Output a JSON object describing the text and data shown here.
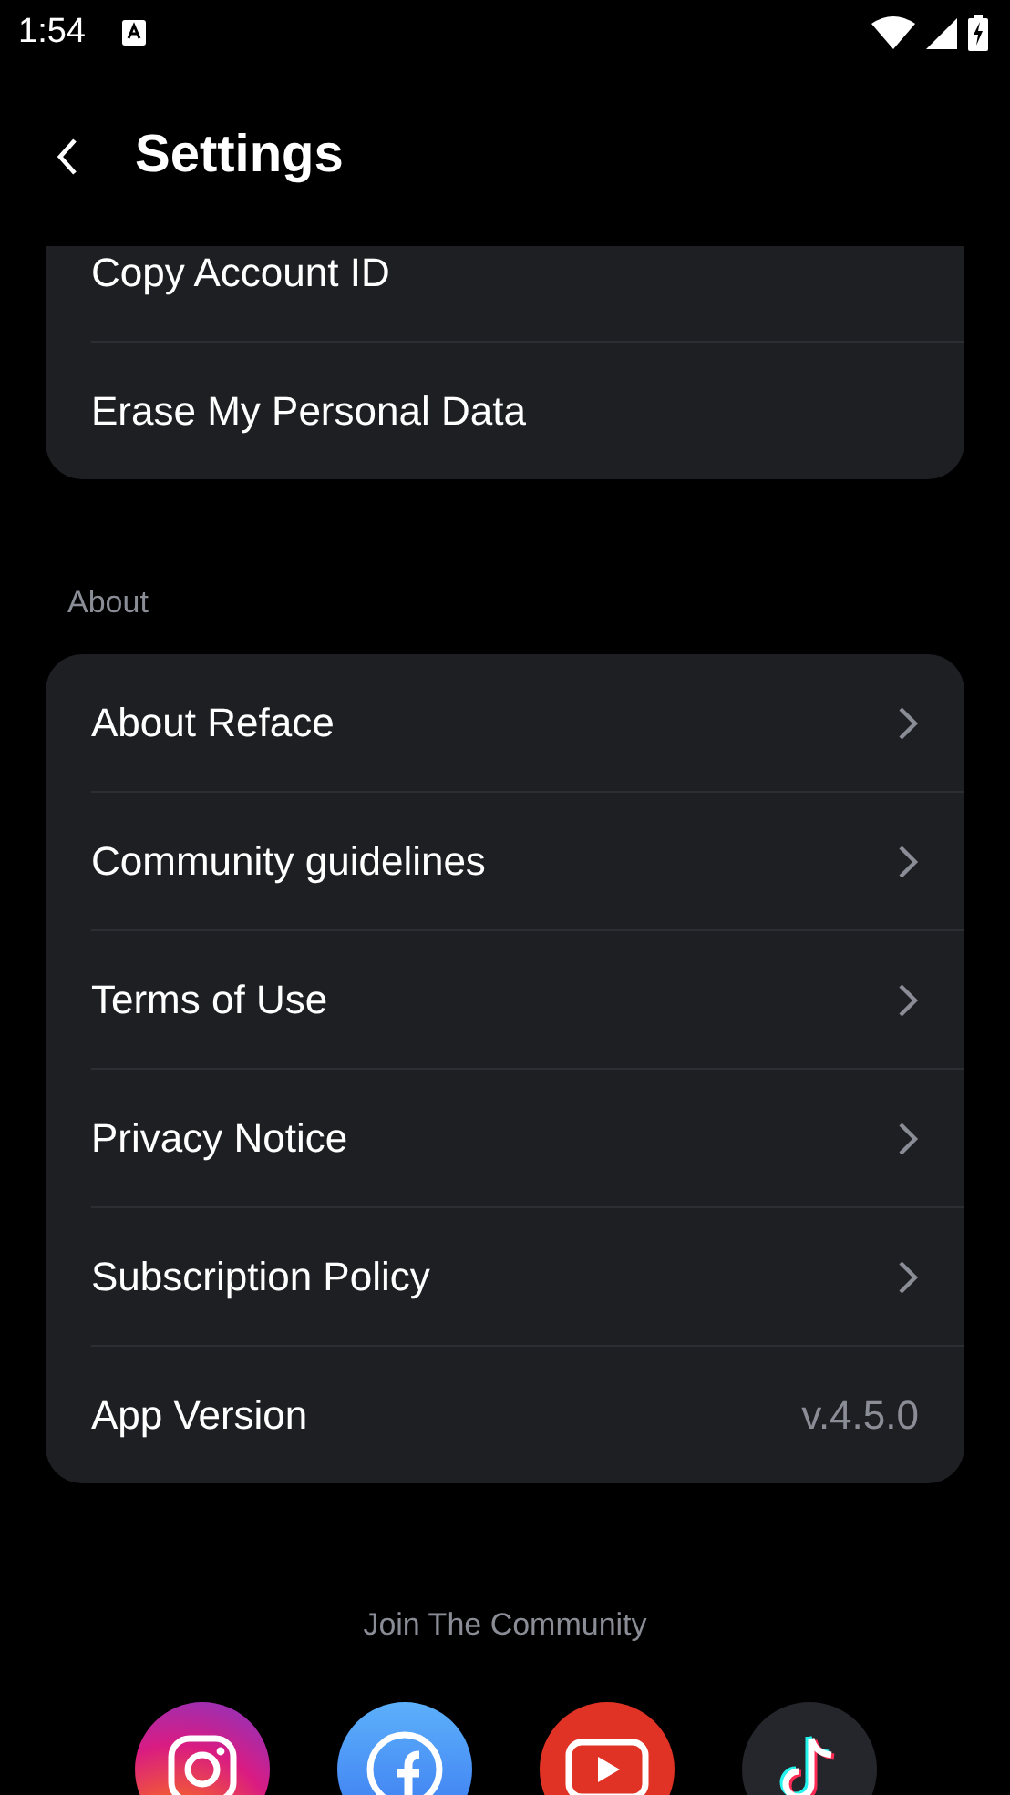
{
  "status_bar": {
    "time": "1:54"
  },
  "header": {
    "title": "Settings"
  },
  "sections": [
    {
      "items": [
        {
          "label": "Copy Account ID",
          "kind": "plain"
        },
        {
          "label": "Erase My Personal Data",
          "kind": "plain"
        }
      ]
    },
    {
      "title": "About",
      "items": [
        {
          "label": "About Reface",
          "kind": "link"
        },
        {
          "label": "Community guidelines",
          "kind": "link"
        },
        {
          "label": "Terms of Use",
          "kind": "link"
        },
        {
          "label": "Privacy Notice",
          "kind": "link"
        },
        {
          "label": "Subscription Policy",
          "kind": "link"
        },
        {
          "label": "App Version",
          "kind": "value",
          "value": "v.4.5.0"
        }
      ]
    }
  ],
  "community": {
    "title": "Join The Community",
    "links": [
      {
        "kind": "instagram"
      },
      {
        "kind": "facebook"
      },
      {
        "kind": "youtube"
      },
      {
        "kind": "tiktok"
      }
    ]
  }
}
